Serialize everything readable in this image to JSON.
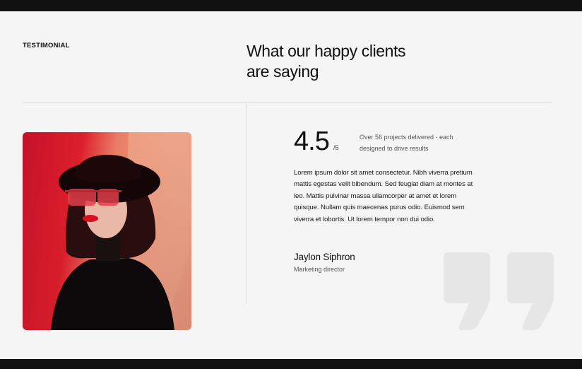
{
  "testimonial": {
    "eyebrow": "TESTIMONIAL",
    "heading_line1": "What our happy clients",
    "heading_line2": "are saying",
    "rating": {
      "value": "4.5",
      "scale": "/5",
      "note": "Over 56 projects delivered - each designed to drive results"
    },
    "quote": "Lorem ipsum dolor sit amet consectetur. Nibh viverra pretium mattis egestas velit bibendum. Sed feugiat diam at montes at leo. Mattis pulvinar massa ullamcorper at amet et lorem quisque. Nullam quis maecenas purus odio. Euismod sem viverra et lobortis. Ut lorem tempor non dui odio.",
    "author": {
      "name": "Jaylon Siphron",
      "role": "Marketing director"
    },
    "photo_icon": "portrait-photo-icon",
    "quote_icon": "quote-mark-icon"
  },
  "colors": {
    "background": "#f5f5f5",
    "frame": "#111111",
    "divider": "#dddddd",
    "quote_mark": "#e6e6e6",
    "photo_red": "#d8142a",
    "photo_peach": "#f7b08a"
  }
}
